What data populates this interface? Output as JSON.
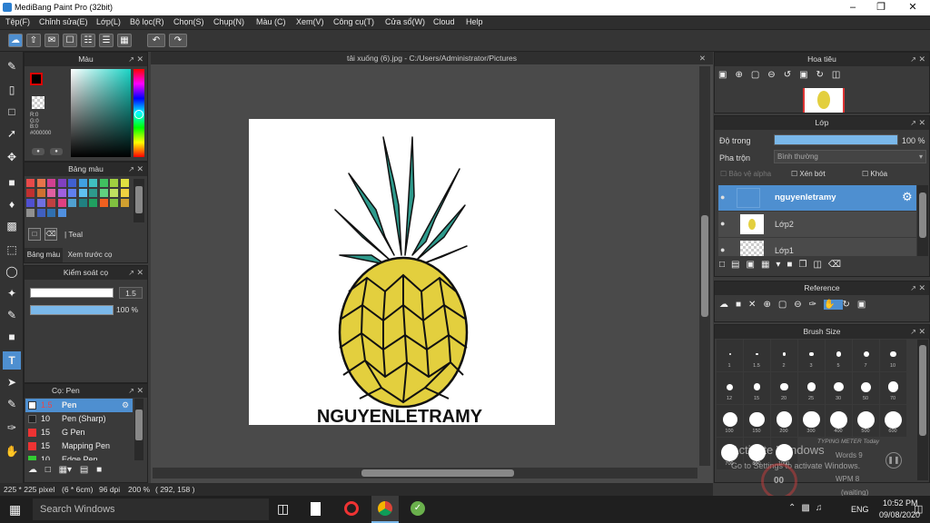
{
  "window": {
    "title": "MediBang Paint Pro (32bit)"
  },
  "menu": [
    "Tệp(F)",
    "Chỉnh sửa(E)",
    "Lớp(L)",
    "Bộ lọc(R)",
    "Chọn(S)",
    "Chụp(N)",
    "Màu (C)",
    "Xem(V)",
    "Công cụ(T)",
    "Cửa sổ(W)",
    "Cloud",
    "Help"
  ],
  "color_panel": {
    "title": "Màu",
    "r": "R:0",
    "g": "G:0",
    "b": "B:0",
    "hex": "#000000"
  },
  "palette_panel": {
    "title": "Bảng màu",
    "selected_name": "Teal",
    "tab1": "Bảng màu",
    "tab2": "Xem trước cọ"
  },
  "brush_control": {
    "title": "Kiểm soát cọ",
    "size": "1.5",
    "opacity": "100 %"
  },
  "brush_panel": {
    "title": "Cọ: Pen",
    "items": [
      {
        "size": "1.5",
        "name": "Pen"
      },
      {
        "size": "10",
        "name": "Pen (Sharp)"
      },
      {
        "size": "15",
        "name": "G Pen"
      },
      {
        "size": "15",
        "name": "Mapping Pen"
      },
      {
        "size": "10",
        "name": "Edge Pen"
      }
    ]
  },
  "canvas": {
    "doc_title": "tải xuống (6).jpg - C:/Users/Administrator/Pictures",
    "artwork_text": "NGUYENLETRAMY"
  },
  "statusbar": {
    "size": "225 * 225 pixel",
    "cm": "(6 * 6cm)",
    "dpi": "96 dpi",
    "zoom": "200 %",
    "coords": "( 292, 158 )"
  },
  "navigator": {
    "title": "Hoa tiêu"
  },
  "layer_panel": {
    "title": "Lớp",
    "opacity_label": "Độ trong",
    "opacity_value": "100 %",
    "opacity_fraction": 1.0,
    "blend_label": "Pha trộn",
    "blend_value": "Bình thường",
    "protect_alpha": "Bảo vệ alpha",
    "clipping": "Xén bớt",
    "lock": "Khóa",
    "layers": [
      "nguyenletramy",
      "Lớp2",
      "Lớp1"
    ]
  },
  "reference": {
    "title": "Reference"
  },
  "brush_size": {
    "title": "Brush Size",
    "sizes": [
      "1",
      "1.5",
      "2",
      "3",
      "5",
      "7",
      "10",
      "12",
      "15",
      "20",
      "25",
      "30",
      "50",
      "70",
      "100",
      "150",
      "200",
      "300",
      "400",
      "500",
      "600",
      "700",
      "800",
      "1000"
    ]
  },
  "overlay": {
    "activate_title": "Activate Windows",
    "activate_sub": "Go to Settings to activate Windows.",
    "typing_title": "TYPING METER Today",
    "words": "Words 9",
    "wpm": "WPM 8",
    "gauge": "00",
    "waiting": "(waiting)"
  },
  "taskbar": {
    "search": "Search Windows",
    "lang": "ENG",
    "time": "10:52 PM",
    "date": "09/08/2020"
  },
  "colors": {
    "layer_selected": "#4e8fd0",
    "brush_selected": "#4e8fd0",
    "pineapple_body": "#e3cf3e",
    "pineapple_leaves": "#2e9a8c"
  }
}
